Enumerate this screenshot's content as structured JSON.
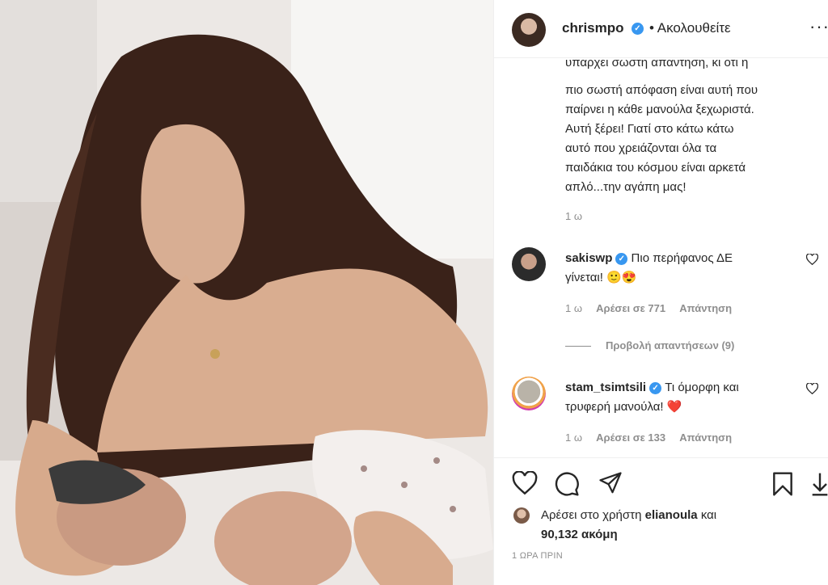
{
  "post_image": {
    "alt_icon": "photo-mother-breastfeeding-twins"
  },
  "header": {
    "username": "chrismpo",
    "verified_icon": "verified-badge-icon",
    "follow_status": "• Ακολουθείτε",
    "more_icon": "more-options-icon",
    "more_glyph": "···"
  },
  "caption": {
    "clipped_line": "υπάρχει σωστή απάντηση, κι ότι η",
    "lines": [
      "πιο σωστή απόφαση είναι αυτή που",
      "παίρνει η κάθε μανούλα ξεχωριστά.",
      "Αυτή ξέρει! Γιατί στο κάτω κάτω",
      "αυτό που χρειάζονται όλα τα",
      "παιδάκια του κόσμου είναι αρκετά",
      "απλό...την αγάπη μας!"
    ],
    "time": "1 ω"
  },
  "comments": [
    {
      "username": "sakiswp",
      "text_line1": "Πιο περήφανος ΔΕ",
      "text_line2": "γίνεται! 🙂😍",
      "time": "1 ω",
      "likes": "Αρέσει σε 771",
      "reply": "Απάντηση"
    },
    {
      "username": "stam_tsimtsili",
      "text_line1": "Τι όμορφη και",
      "text_line2": "τρυφερή μανούλα! ❤️",
      "time": "1 ω",
      "likes": "Αρέσει σε 133",
      "reply": "Απάντηση"
    }
  ],
  "view_replies": "Προβολή απαντήσεων (9)",
  "actions": {
    "like_icon": "heart-icon",
    "comment_icon": "comment-icon",
    "share_icon": "share-icon",
    "save_icon": "bookmark-icon",
    "extra_icon": "download-icon"
  },
  "likes": {
    "prefix": "Αρέσει στο χρήστη",
    "user": "elianoula",
    "joiner": "και",
    "count": "90,132 ακόμη"
  },
  "posted": "1 ΩΡΑ ΠΡΙΝ",
  "colors": {
    "verified": "#3897f0",
    "secondary_text": "#8e8e8e",
    "heart_red": "#ed4956"
  }
}
